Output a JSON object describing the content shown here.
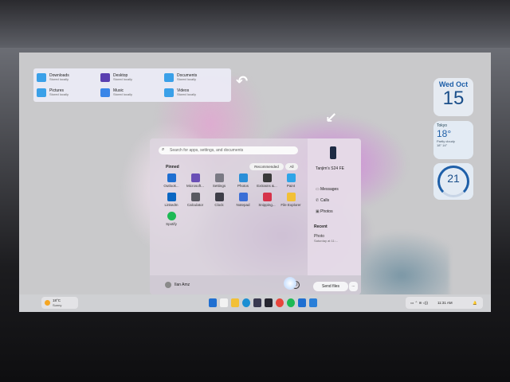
{
  "files": [
    {
      "name": "Downloads",
      "sub": "Stored locally",
      "color": "#3aa0e8",
      "icon": "downloads-folder-icon"
    },
    {
      "name": "Desktop",
      "sub": "Stored locally",
      "color": "#5a3fb0",
      "icon": "desktop-folder-icon"
    },
    {
      "name": "Documents",
      "sub": "Stored locally",
      "color": "#3aa0e8",
      "icon": "documents-folder-icon"
    },
    {
      "name": "Pictures",
      "sub": "Stored locally",
      "color": "#3aa0e8",
      "icon": "pictures-folder-icon"
    },
    {
      "name": "Music",
      "sub": "Stored locally",
      "color": "#3a86e8",
      "icon": "music-folder-icon"
    },
    {
      "name": "Videos",
      "sub": "Stored locally",
      "color": "#3aa0e8",
      "icon": "videos-folder-icon"
    }
  ],
  "widgets": {
    "calendar": {
      "weekday": "Wed",
      "month": "Oct",
      "day": "15"
    },
    "weather": {
      "city": "Tokyo",
      "temp": "18°",
      "cond": "Partly cloudy",
      "range": "18° 14°"
    },
    "clock": {
      "value": "21"
    }
  },
  "start": {
    "search_placeholder": "Search for apps, settings, and documents",
    "pinned_title": "Pinned",
    "recommended_label": "Recommended",
    "all_label": "All",
    "apps": [
      {
        "label": "Outlook...",
        "color": "#1f6fd1",
        "icon": "outlook-icon"
      },
      {
        "label": "Microsoft...",
        "color": "#6a4fb6",
        "icon": "microsoft-store-icon"
      },
      {
        "label": "Settings",
        "color": "#7a7a84",
        "icon": "settings-gear-icon"
      },
      {
        "label": "Photos",
        "color": "#2a8fd8",
        "icon": "photos-icon"
      },
      {
        "label": "Extrasns &...",
        "color": "#3a3a3a",
        "icon": "extensions-icon"
      },
      {
        "label": "Paint",
        "color": "#2fa4e7",
        "icon": "paint-icon"
      },
      {
        "label": "LinkedIn",
        "color": "#0a66c2",
        "icon": "linkedin-icon"
      },
      {
        "label": "Calculator",
        "color": "#5a5a62",
        "icon": "calculator-icon"
      },
      {
        "label": "Clock",
        "color": "#3e3e48",
        "icon": "clock-icon"
      },
      {
        "label": "Notepad",
        "color": "#3b6fd6",
        "icon": "notepad-icon"
      },
      {
        "label": "Snipping...",
        "color": "#d6334a",
        "icon": "snipping-tool-icon"
      },
      {
        "label": "File Explorer",
        "color": "#f2c036",
        "icon": "file-explorer-icon"
      },
      {
        "label": "Spotify",
        "color": "#1db954",
        "icon": "spotify-icon"
      }
    ],
    "user_name": "Ilan Amz",
    "power_glyph": "⏻"
  },
  "phone": {
    "name": "Tanjim's S24 FE",
    "links": [
      "Messages",
      "Calls",
      "Photos"
    ],
    "recent_title": "Recent",
    "recent_item": "Photo",
    "recent_sub": "Saturday at 11:..."
  },
  "send_files": "Send files",
  "more": "...",
  "taskbar": {
    "weather_temp": "18°C",
    "weather_cond": "Sunny",
    "time": "11:31 AM",
    "icons": [
      {
        "name": "windows-start-icon",
        "color": "#1f6fd1"
      },
      {
        "name": "search-taskbar-icon",
        "color": "#f2f2f2"
      },
      {
        "name": "file-explorer-taskbar-icon",
        "color": "#f2c036"
      },
      {
        "name": "edge-taskbar-icon",
        "color": "#1b8fd3"
      },
      {
        "name": "store-taskbar-icon",
        "color": "#3a3a50"
      },
      {
        "name": "terminal-taskbar-icon",
        "color": "#262630"
      },
      {
        "name": "chrome-taskbar-icon",
        "color": "#e8453c"
      },
      {
        "name": "spotify-taskbar-icon",
        "color": "#1db954"
      },
      {
        "name": "outlook-taskbar-icon",
        "color": "#1f6fd1"
      },
      {
        "name": "phone-link-taskbar-icon",
        "color": "#2a7fd8"
      }
    ]
  }
}
